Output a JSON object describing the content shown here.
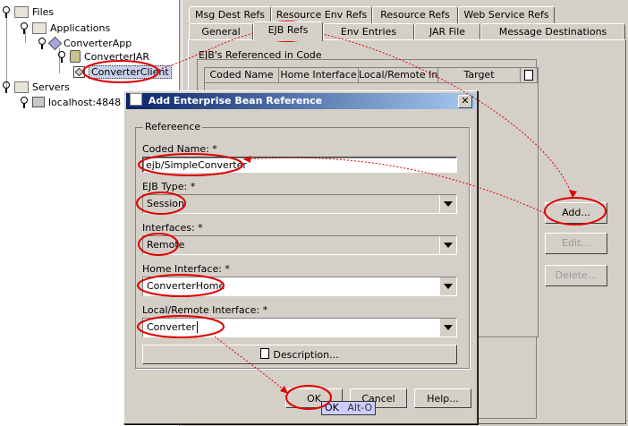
{
  "tree": {
    "items": [
      {
        "label": "Files"
      },
      {
        "label": "Applications"
      },
      {
        "label": "ConverterApp"
      },
      {
        "label": "ConverterJAR"
      },
      {
        "label": "ConverterClient"
      },
      {
        "label": "Servers"
      },
      {
        "label": "localhost:4848"
      }
    ]
  },
  "tabs": {
    "row1": [
      "Msg Dest Refs",
      "Resource Env Refs",
      "Resource Refs",
      "Web Service Refs"
    ],
    "row2": [
      "General",
      "EJB Refs",
      "Env Entries",
      "JAR File",
      "Message Destinations"
    ]
  },
  "ejb_panel": {
    "title": "EJB's Referenced in Code",
    "columns": [
      "Coded Name",
      "Home Interface",
      "Local/Remote In...",
      "Target"
    ],
    "buttons": {
      "add": "Add...",
      "edit": "Edit...",
      "delete": "Delete..."
    }
  },
  "dialog": {
    "title": "Add Enterprise Bean Reference",
    "group_title": "Refereence",
    "coded_name_label": "Coded Name: *",
    "coded_name_value": "ejb/SimpleConverter",
    "ejb_type_label": "EJB Type: *",
    "ejb_type_value": "Session",
    "interfaces_label": "Interfaces: *",
    "interfaces_value": "Remote",
    "home_label": "Home Interface: *",
    "home_value": "ConverterHome",
    "local_remote_label": "Local/Remote Interface: *",
    "local_remote_value": "Converter",
    "description_button": "Description...",
    "ok": "OK",
    "cancel": "Cancel",
    "help": "Help...",
    "tooltip_text": "OK",
    "tooltip_shortcut": "Alt-O"
  },
  "colors": {
    "annotation": "#e00000",
    "title_bar": "#0a246a",
    "tree_selected": "#c8d2ea"
  }
}
